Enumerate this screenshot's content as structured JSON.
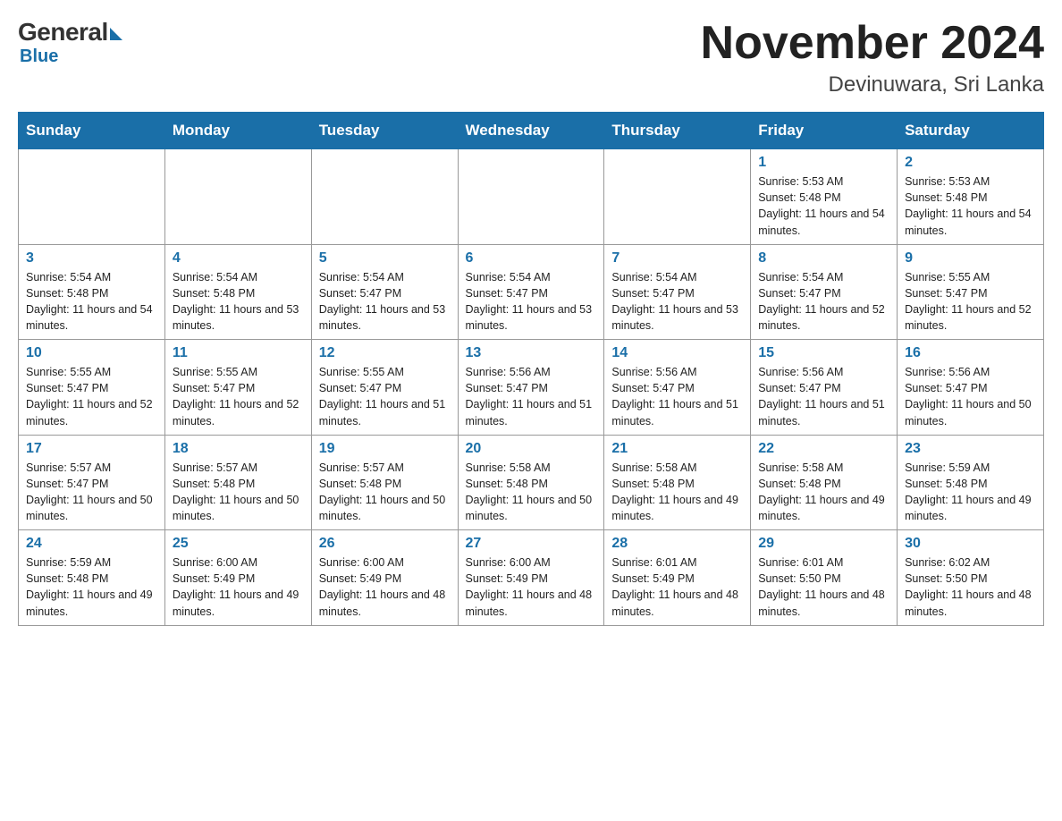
{
  "header": {
    "logo_general": "General",
    "logo_blue": "Blue",
    "month_title": "November 2024",
    "location": "Devinuwara, Sri Lanka"
  },
  "days_of_week": [
    "Sunday",
    "Monday",
    "Tuesday",
    "Wednesday",
    "Thursday",
    "Friday",
    "Saturday"
  ],
  "weeks": [
    [
      {
        "day": "",
        "info": ""
      },
      {
        "day": "",
        "info": ""
      },
      {
        "day": "",
        "info": ""
      },
      {
        "day": "",
        "info": ""
      },
      {
        "day": "",
        "info": ""
      },
      {
        "day": "1",
        "info": "Sunrise: 5:53 AM\nSunset: 5:48 PM\nDaylight: 11 hours and 54 minutes."
      },
      {
        "day": "2",
        "info": "Sunrise: 5:53 AM\nSunset: 5:48 PM\nDaylight: 11 hours and 54 minutes."
      }
    ],
    [
      {
        "day": "3",
        "info": "Sunrise: 5:54 AM\nSunset: 5:48 PM\nDaylight: 11 hours and 54 minutes."
      },
      {
        "day": "4",
        "info": "Sunrise: 5:54 AM\nSunset: 5:48 PM\nDaylight: 11 hours and 53 minutes."
      },
      {
        "day": "5",
        "info": "Sunrise: 5:54 AM\nSunset: 5:47 PM\nDaylight: 11 hours and 53 minutes."
      },
      {
        "day": "6",
        "info": "Sunrise: 5:54 AM\nSunset: 5:47 PM\nDaylight: 11 hours and 53 minutes."
      },
      {
        "day": "7",
        "info": "Sunrise: 5:54 AM\nSunset: 5:47 PM\nDaylight: 11 hours and 53 minutes."
      },
      {
        "day": "8",
        "info": "Sunrise: 5:54 AM\nSunset: 5:47 PM\nDaylight: 11 hours and 52 minutes."
      },
      {
        "day": "9",
        "info": "Sunrise: 5:55 AM\nSunset: 5:47 PM\nDaylight: 11 hours and 52 minutes."
      }
    ],
    [
      {
        "day": "10",
        "info": "Sunrise: 5:55 AM\nSunset: 5:47 PM\nDaylight: 11 hours and 52 minutes."
      },
      {
        "day": "11",
        "info": "Sunrise: 5:55 AM\nSunset: 5:47 PM\nDaylight: 11 hours and 52 minutes."
      },
      {
        "day": "12",
        "info": "Sunrise: 5:55 AM\nSunset: 5:47 PM\nDaylight: 11 hours and 51 minutes."
      },
      {
        "day": "13",
        "info": "Sunrise: 5:56 AM\nSunset: 5:47 PM\nDaylight: 11 hours and 51 minutes."
      },
      {
        "day": "14",
        "info": "Sunrise: 5:56 AM\nSunset: 5:47 PM\nDaylight: 11 hours and 51 minutes."
      },
      {
        "day": "15",
        "info": "Sunrise: 5:56 AM\nSunset: 5:47 PM\nDaylight: 11 hours and 51 minutes."
      },
      {
        "day": "16",
        "info": "Sunrise: 5:56 AM\nSunset: 5:47 PM\nDaylight: 11 hours and 50 minutes."
      }
    ],
    [
      {
        "day": "17",
        "info": "Sunrise: 5:57 AM\nSunset: 5:47 PM\nDaylight: 11 hours and 50 minutes."
      },
      {
        "day": "18",
        "info": "Sunrise: 5:57 AM\nSunset: 5:48 PM\nDaylight: 11 hours and 50 minutes."
      },
      {
        "day": "19",
        "info": "Sunrise: 5:57 AM\nSunset: 5:48 PM\nDaylight: 11 hours and 50 minutes."
      },
      {
        "day": "20",
        "info": "Sunrise: 5:58 AM\nSunset: 5:48 PM\nDaylight: 11 hours and 50 minutes."
      },
      {
        "day": "21",
        "info": "Sunrise: 5:58 AM\nSunset: 5:48 PM\nDaylight: 11 hours and 49 minutes."
      },
      {
        "day": "22",
        "info": "Sunrise: 5:58 AM\nSunset: 5:48 PM\nDaylight: 11 hours and 49 minutes."
      },
      {
        "day": "23",
        "info": "Sunrise: 5:59 AM\nSunset: 5:48 PM\nDaylight: 11 hours and 49 minutes."
      }
    ],
    [
      {
        "day": "24",
        "info": "Sunrise: 5:59 AM\nSunset: 5:48 PM\nDaylight: 11 hours and 49 minutes."
      },
      {
        "day": "25",
        "info": "Sunrise: 6:00 AM\nSunset: 5:49 PM\nDaylight: 11 hours and 49 minutes."
      },
      {
        "day": "26",
        "info": "Sunrise: 6:00 AM\nSunset: 5:49 PM\nDaylight: 11 hours and 48 minutes."
      },
      {
        "day": "27",
        "info": "Sunrise: 6:00 AM\nSunset: 5:49 PM\nDaylight: 11 hours and 48 minutes."
      },
      {
        "day": "28",
        "info": "Sunrise: 6:01 AM\nSunset: 5:49 PM\nDaylight: 11 hours and 48 minutes."
      },
      {
        "day": "29",
        "info": "Sunrise: 6:01 AM\nSunset: 5:50 PM\nDaylight: 11 hours and 48 minutes."
      },
      {
        "day": "30",
        "info": "Sunrise: 6:02 AM\nSunset: 5:50 PM\nDaylight: 11 hours and 48 minutes."
      }
    ]
  ]
}
